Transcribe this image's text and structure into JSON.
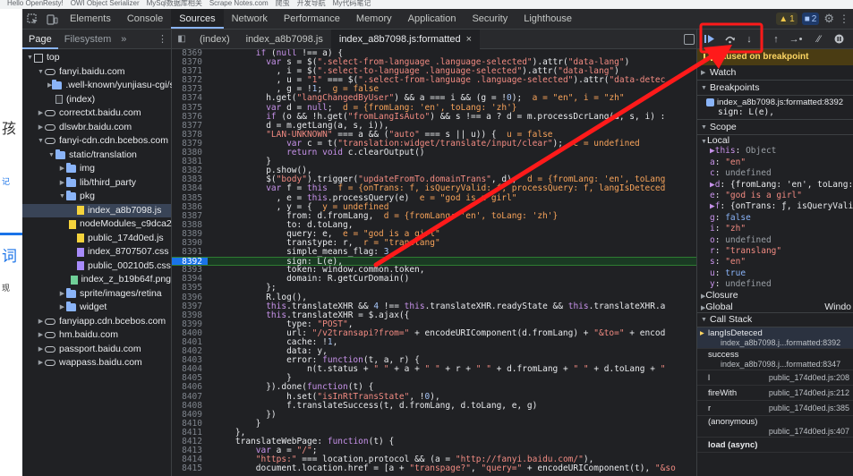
{
  "bookmarks": [
    "Hello OpenResty!",
    "OWI Object Serializer",
    "MySql数据库相关",
    "Scrape Notes.com",
    "爬虫",
    "开发导航",
    "My代码笔记"
  ],
  "page_fragments": [
    "孩",
    "记",
    "词",
    "现"
  ],
  "devtools_tabs": [
    {
      "label": "Elements"
    },
    {
      "label": "Console"
    },
    {
      "label": "Sources"
    },
    {
      "label": "Network"
    },
    {
      "label": "Performance"
    },
    {
      "label": "Memory"
    },
    {
      "label": "Application"
    },
    {
      "label": "Security"
    },
    {
      "label": "Lighthouse"
    }
  ],
  "badges": {
    "warnings": "1",
    "messages": "2"
  },
  "navigator": {
    "tabs": [
      "Page",
      "Filesystem"
    ],
    "more": "»",
    "tree": [
      {
        "label": "top",
        "icon": "frame",
        "indent": 0,
        "arrow": "▼"
      },
      {
        "label": "fanyi.baidu.com",
        "icon": "cloud",
        "indent": 1,
        "arrow": "▼"
      },
      {
        "label": ".well-known/yunjiasu-cgi/sc",
        "icon": "folder",
        "indent": 2,
        "arrow": "▶"
      },
      {
        "label": "(index)",
        "icon": "file",
        "indent": 2,
        "arrow": ""
      },
      {
        "label": "correctxt.baidu.com",
        "icon": "cloud",
        "indent": 1,
        "arrow": "▶"
      },
      {
        "label": "dlswbr.baidu.com",
        "icon": "cloud",
        "indent": 1,
        "arrow": "▶"
      },
      {
        "label": "fanyi-cdn.cdn.bcebos.com",
        "icon": "cloud",
        "indent": 1,
        "arrow": "▼"
      },
      {
        "label": "static/translation",
        "icon": "folder",
        "indent": 2,
        "arrow": "▼"
      },
      {
        "label": "img",
        "icon": "folder",
        "indent": 3,
        "arrow": "▶"
      },
      {
        "label": "lib/third_party",
        "icon": "folder",
        "indent": 3,
        "arrow": "▶"
      },
      {
        "label": "pkg",
        "icon": "folder",
        "indent": 3,
        "arrow": "▼"
      },
      {
        "label": "index_a8b7098.js",
        "icon": "js",
        "indent": 4,
        "arrow": "",
        "selected": true
      },
      {
        "label": "nodeModules_c9dca2e",
        "icon": "js",
        "indent": 4,
        "arrow": ""
      },
      {
        "label": "public_174d0ed.js",
        "icon": "js",
        "indent": 4,
        "arrow": ""
      },
      {
        "label": "index_8707507.css",
        "icon": "css",
        "indent": 4,
        "arrow": ""
      },
      {
        "label": "public_00210d5.css",
        "icon": "css",
        "indent": 4,
        "arrow": ""
      },
      {
        "label": "index_z_b19b64f.png",
        "icon": "png",
        "indent": 4,
        "arrow": ""
      },
      {
        "label": "sprite/images/retina",
        "icon": "folder",
        "indent": 3,
        "arrow": "▶"
      },
      {
        "label": "widget",
        "icon": "folder",
        "indent": 3,
        "arrow": "▶"
      },
      {
        "label": "fanyiapp.cdn.bcebos.com",
        "icon": "cloud",
        "indent": 1,
        "arrow": "▶"
      },
      {
        "label": "hm.baidu.com",
        "icon": "cloud",
        "indent": 1,
        "arrow": "▶"
      },
      {
        "label": "passport.baidu.com",
        "icon": "cloud",
        "indent": 1,
        "arrow": "▶"
      },
      {
        "label": "wappass.baidu.com",
        "icon": "cloud",
        "indent": 1,
        "arrow": "▶"
      }
    ]
  },
  "file_tabs": [
    {
      "label": "(index)"
    },
    {
      "label": "index_a8b7098.js"
    },
    {
      "label": "index_a8b7098.js:formatted",
      "active": true
    }
  ],
  "breakpoint_line": 8392,
  "code_lines": [
    {
      "n": "8369",
      "html": "        <span class='k'>if</span> (<span class='k'>null</span> !== a) {"
    },
    {
      "n": "8370",
      "html": "          <span class='k'>var</span> s = $(<span class='s'>\".select-from-language .language-selected\"</span>).attr(<span class='s'>\"data-lang\"</span>)"
    },
    {
      "n": "8371",
      "html": "            , i = $(<span class='s'>\".select-to-language .language-selected\"</span>).attr(<span class='s'>\"data-lang\"</span>)"
    },
    {
      "n": "8372",
      "html": "            , u = <span class='s'>\"1\"</span> === $(<span class='s'>\".select-from-language .language-selected\"</span>).attr(<span class='s'>\"data-detec</span>"
    },
    {
      "n": "8373",
      "html": "            , g = !<span class='n'>1</span>;  <span class='inl'>g = false</span>"
    },
    {
      "n": "8374",
      "html": "          h.get(<span class='s'>\"langChangedByUser\"</span>) &amp;&amp; a === i &amp;&amp; (g = !<span class='n'>0</span>);  <span class='inl'>a = \"en\", i = \"zh\"</span>"
    },
    {
      "n": "8375",
      "html": "          <span class='k'>var</span> d = <span class='k'>null</span>;  <span class='inl'>d = {fromLang: 'en', toLang: 'zh'}</span>"
    },
    {
      "n": "8376",
      "html": "          <span class='k'>if</span> (o &amp;&amp; !h.get(<span class='s'>\"fromLangIsAuto\"</span>) &amp;&amp; s !== a ? d = m.processDcrLang(a, s, i) :"
    },
    {
      "n": "8377",
      "html": "          d = m.getLang(a, s, i)),"
    },
    {
      "n": "8378",
      "html": "          <span class='s'>\"LAN-UNKNOWN\"</span> === a &amp;&amp; (<span class='s'>\"auto\"</span> === s || u)) {  <span class='inl'>u = false</span>"
    },
    {
      "n": "8379",
      "html": "              <span class='k'>var</span> c = t(<span class='s'>\"translation:widget/translate/input/clear\"</span>);  <span class='inl'>c = undefined</span>"
    },
    {
      "n": "8380",
      "html": "              <span class='k'>return void</span> c.clearOutput()"
    },
    {
      "n": "8381",
      "html": "          }"
    },
    {
      "n": "8382",
      "html": "          p.show(),"
    },
    {
      "n": "8383",
      "html": "          $(<span class='s'>\"body\"</span>).trigger(<span class='s'>\"updateFromTo.domainTrans\"</span>, d);  <span class='inl'>d = {fromLang: 'en', toLang</span>"
    },
    {
      "n": "8384",
      "html": "          <span class='k'>var</span> f = <span class='k'>this</span>  <span class='inl'>f = {onTrans: f, isQueryValid: f, processQuery: f, langIsDeteced</span>"
    },
    {
      "n": "8385",
      "html": "            , e = <span class='k'>this</span>.processQuery(e)  <span class='inl'>e = \"god is a girl\"</span>"
    },
    {
      "n": "8386",
      "html": "            , y = {  <span class='inl'>y = undefined</span>"
    },
    {
      "n": "8387",
      "html": "              from: d.fromLang,  <span class='inl'>d = {fromLang: 'en', toLang: 'zh'}</span>"
    },
    {
      "n": "8388",
      "html": "              to: d.toLang,"
    },
    {
      "n": "8389",
      "html": "              query: e,  <span class='inl'>e = \"god is a girl\"</span>"
    },
    {
      "n": "8390",
      "html": "              transtype: r,  <span class='inl'>r = \"translang\"</span>"
    },
    {
      "n": "8391",
      "html": "              simple_means_flag: <span class='n'>3</span>,"
    },
    {
      "n": "8392",
      "html": "              sign: L(e),",
      "bp": true
    },
    {
      "n": "8393",
      "html": "              token: window.common.token,"
    },
    {
      "n": "8394",
      "html": "              domain: R.getCurDomain()"
    },
    {
      "n": "8395",
      "html": "          };"
    },
    {
      "n": "8396",
      "html": "          R.log(),"
    },
    {
      "n": "8397",
      "html": "          <span class='k'>this</span>.translateXHR &amp;&amp; <span class='n'>4</span> !== <span class='k'>this</span>.translateXHR.readyState &amp;&amp; <span class='k'>this</span>.translateXHR.a"
    },
    {
      "n": "8398",
      "html": "          <span class='k'>this</span>.translateXHR = $.ajax({"
    },
    {
      "n": "8399",
      "html": "              type: <span class='s'>\"POST\"</span>,"
    },
    {
      "n": "8400",
      "html": "              url: <span class='s'>\"/v2transapi?from=\"</span> + encodeURIComponent(d.fromLang) + <span class='s'>\"&amp;to=\"</span> + encod"
    },
    {
      "n": "8401",
      "html": "              cache: !<span class='n'>1</span>,"
    },
    {
      "n": "8402",
      "html": "              data: y,"
    },
    {
      "n": "8403",
      "html": "              error: <span class='k'>function</span>(t, a, r) {"
    },
    {
      "n": "8404",
      "html": "                  n(t.status + <span class='s'>\" \"</span> + a + <span class='s'>\" \"</span> + r + <span class='s'>\" \"</span> + d.fromLang + <span class='s'>\" \"</span> + d.toLang + <span class='s'>\"</span>"
    },
    {
      "n": "8405",
      "html": "              }"
    },
    {
      "n": "8406",
      "html": "          }).done(<span class='k'>function</span>(t) {"
    },
    {
      "n": "8407",
      "html": "              h.set(<span class='s'>\"isInRtTransState\"</span>, !<span class='n'>0</span>),"
    },
    {
      "n": "8408",
      "html": "              f.translateSuccess(t, d.fromLang, d.toLang, e, g)"
    },
    {
      "n": "8409",
      "html": "          })"
    },
    {
      "n": "8410",
      "html": "        }"
    },
    {
      "n": "8411",
      "html": "    },"
    },
    {
      "n": "8412",
      "html": "    translateWebPage: <span class='k'>function</span>(t) {"
    },
    {
      "n": "8413",
      "html": "        <span class='k'>var</span> a = <span class='s'>\"/\"</span>;"
    },
    {
      "n": "8414",
      "html": "        <span class='s'>\"https:\"</span> === location.protocol &amp;&amp; (a = <span class='s'>\"http://fanyi.baidu.com/\"</span>),"
    },
    {
      "n": "8415",
      "html": "        document.location.href = [a + <span class='s'>\"transpage?\"</span>, <span class='s'>\"query=\"</span> + encodeURIComponent(t), <span class='s'>\"&amp;so</span>"
    }
  ],
  "debugger": {
    "paused_label": "Paused on breakpoint",
    "sections": {
      "watch": "Watch",
      "breakpoints": "Breakpoints",
      "scope": "Scope",
      "call_stack": "Call Stack"
    },
    "breakpoint": {
      "file": "index_a8b7098.js:formatted:8392",
      "code": "sign: L(e),"
    },
    "scope_local": "Local",
    "scope_rows": [
      {
        "k": "▶this",
        "v": "Object",
        "cls": "vu"
      },
      {
        "k": "a",
        "v": "\"en\"",
        "cls": "vs"
      },
      {
        "k": "c",
        "v": "undefined",
        "cls": "vu"
      },
      {
        "k": "▶d",
        "v": "{fromLang: 'en', toLang:",
        "cls": ""
      },
      {
        "k": "e",
        "v": "\"god is a girl\"",
        "cls": "vs"
      },
      {
        "k": "▶f",
        "v": "{onTrans: ƒ, isQueryValid:",
        "cls": ""
      },
      {
        "k": "g",
        "v": "false",
        "cls": "vn"
      },
      {
        "k": "i",
        "v": "\"zh\"",
        "cls": "vs"
      },
      {
        "k": "o",
        "v": "undefined",
        "cls": "vu"
      },
      {
        "k": "r",
        "v": "\"translang\"",
        "cls": "vs"
      },
      {
        "k": "s",
        "v": "\"en\"",
        "cls": "vs"
      },
      {
        "k": "u",
        "v": "true",
        "cls": "vn"
      },
      {
        "k": "y",
        "v": "undefined",
        "cls": "vu"
      }
    ],
    "closure": "Closure",
    "global": "Global",
    "global_value": "Windo",
    "call_stack": [
      {
        "fn": "langIsDeteced",
        "loc": "index_a8b7098.j...formatted:8392",
        "active": true
      },
      {
        "fn": "success",
        "loc": "index_a8b7098.j...formatted:8347"
      },
      {
        "fn": "l",
        "loc": "public_174d0ed.js:208",
        "flat": true
      },
      {
        "fn": "fireWith",
        "loc": "public_174d0ed.js:212",
        "flat": true
      },
      {
        "fn": "r",
        "loc": "public_174d0ed.js:385",
        "flat": true
      },
      {
        "fn": "(anonymous)",
        "loc": "public_174d0ed.js:407",
        "multi": true
      },
      {
        "fn": "load (async)",
        "loc": "",
        "flat": true
      }
    ]
  },
  "annotation": {
    "color": "#ff1a1a"
  }
}
